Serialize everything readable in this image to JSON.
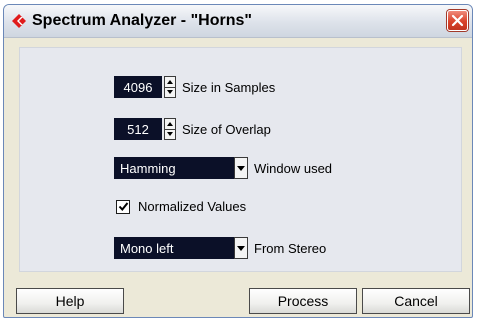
{
  "window": {
    "title": "Spectrum Analyzer - \"Horns\""
  },
  "size_in_samples": {
    "value": "4096",
    "label": "Size in Samples"
  },
  "size_of_overlap": {
    "value": "512",
    "label": "Size of Overlap"
  },
  "window_used": {
    "selected": "Hamming",
    "label": "Window used"
  },
  "normalized_values": {
    "checked": true,
    "label": "Normalized Values"
  },
  "from_stereo": {
    "selected": "Mono left",
    "label": "From Stereo"
  },
  "buttons": {
    "help": "Help",
    "process": "Process",
    "cancel": "Cancel"
  },
  "colors": {
    "field_bg": "#0b1028",
    "dialog_bg": "#ece9d8",
    "panel_bg": "#e6e8ee",
    "close_red": "#d9432b",
    "icon_red": "#e01b1b"
  }
}
